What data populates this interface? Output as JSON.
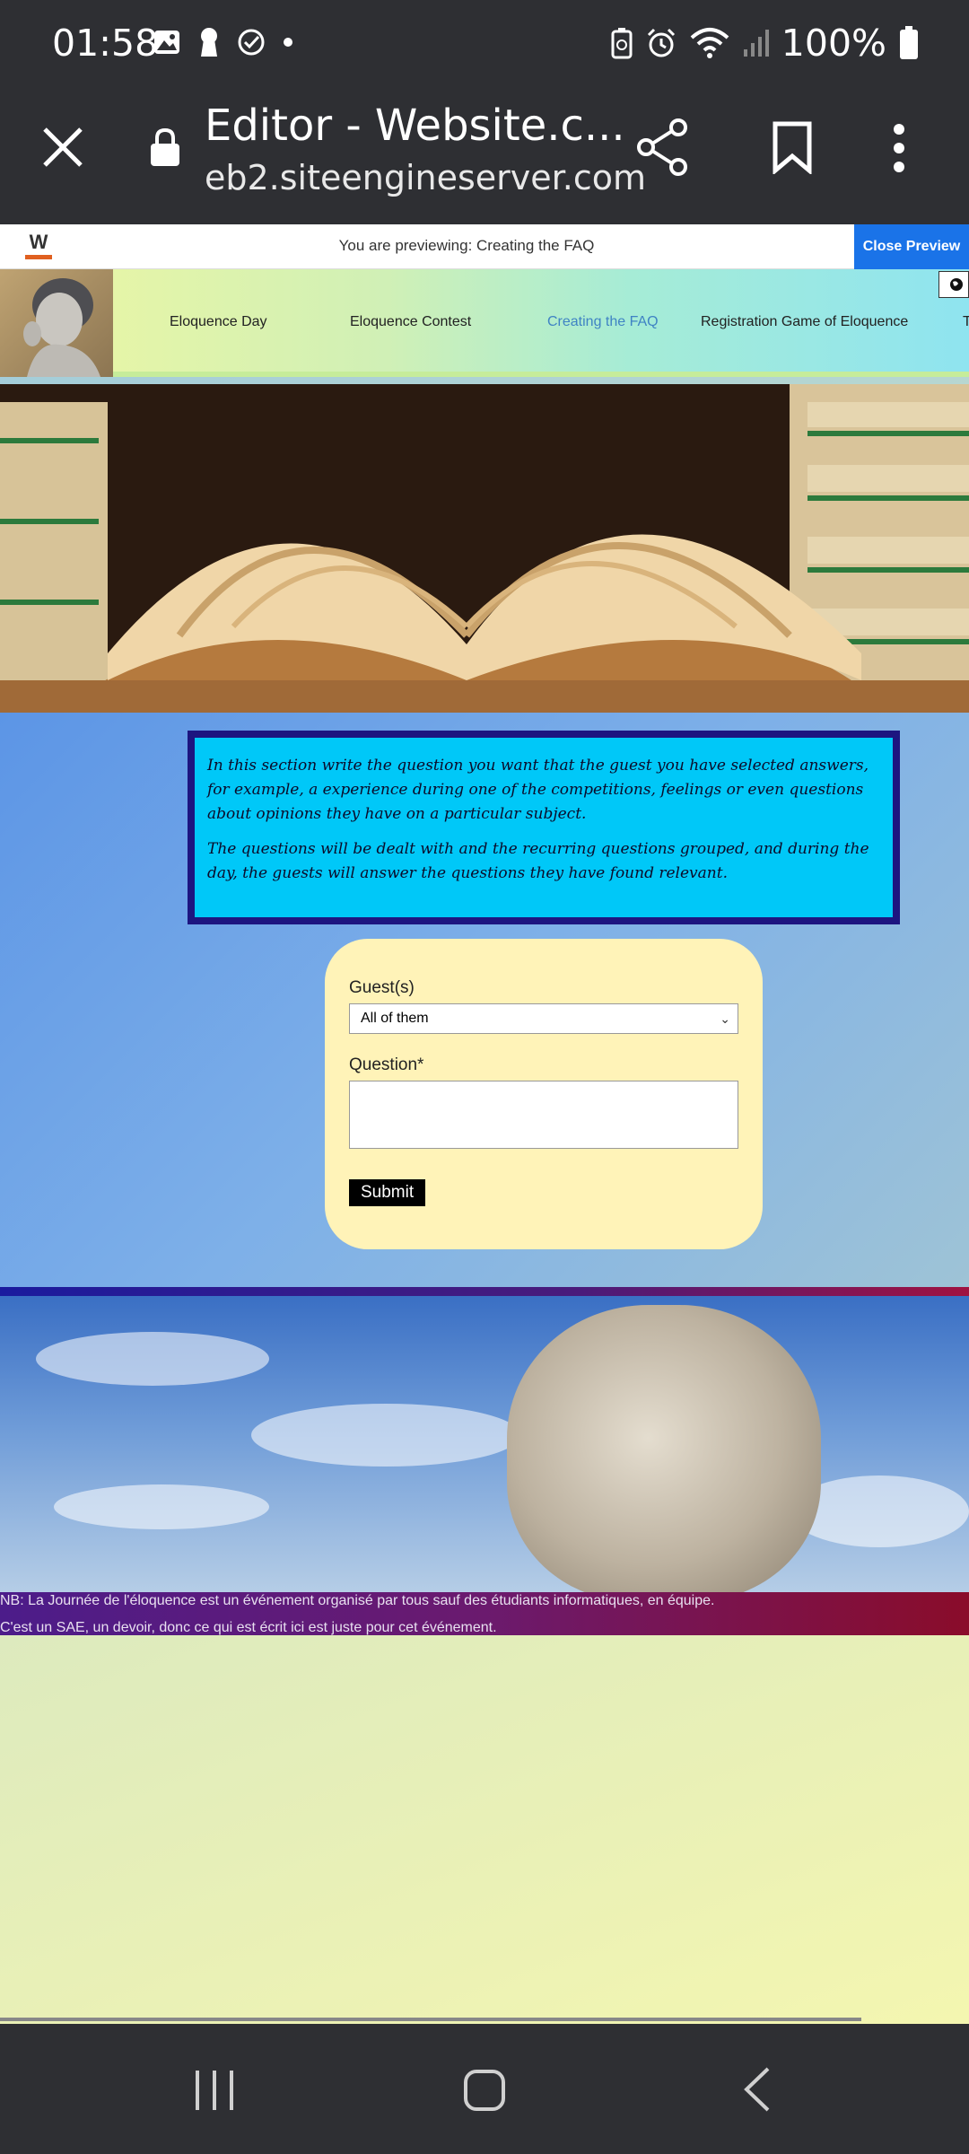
{
  "status_bar": {
    "time": "01:58",
    "battery": "100%"
  },
  "browser": {
    "page_title": "Editor - Website.c...",
    "url": "eb2.siteengineserver.com"
  },
  "preview_bar": {
    "logo_letter": "W",
    "text": "You are previewing: Creating the FAQ",
    "close_label": "Close Preview"
  },
  "site_nav": {
    "items": [
      {
        "label": "Eloquence Day"
      },
      {
        "label": "Eloquence Contest"
      },
      {
        "label": "Creating the FAQ"
      },
      {
        "label": "Registration Game of Eloquence"
      },
      {
        "label": "T"
      }
    ]
  },
  "info": {
    "paragraph1": "In this section write the question you want that the guest you have selected answers, for example, a experience during one of the competitions, feelings or even questions about opinions they have on a particular subject.",
    "paragraph2": "The questions will be dealt with and the recurring questions grouped, and during the day, the guests will answer the questions they have found relevant."
  },
  "form": {
    "guest_label": "Guest(s)",
    "guest_selected": "All of them",
    "question_label": "Question*",
    "submit_label": "Submit"
  },
  "footer": {
    "line1": "NB: La Journée de l'éloquence est un événement organisé par tous sauf des étudiants informatiques, en équipe.",
    "line2": "C'est un SAE, un devoir, donc ce qui est écrit ici est juste pour cet événement."
  },
  "colors": {
    "preview_close": "#1a73e8",
    "info_box_bg": "#00c8f8",
    "info_box_border": "#1d1580",
    "form_bg": "#fff3b8",
    "active_nav": "#3f83c4"
  }
}
